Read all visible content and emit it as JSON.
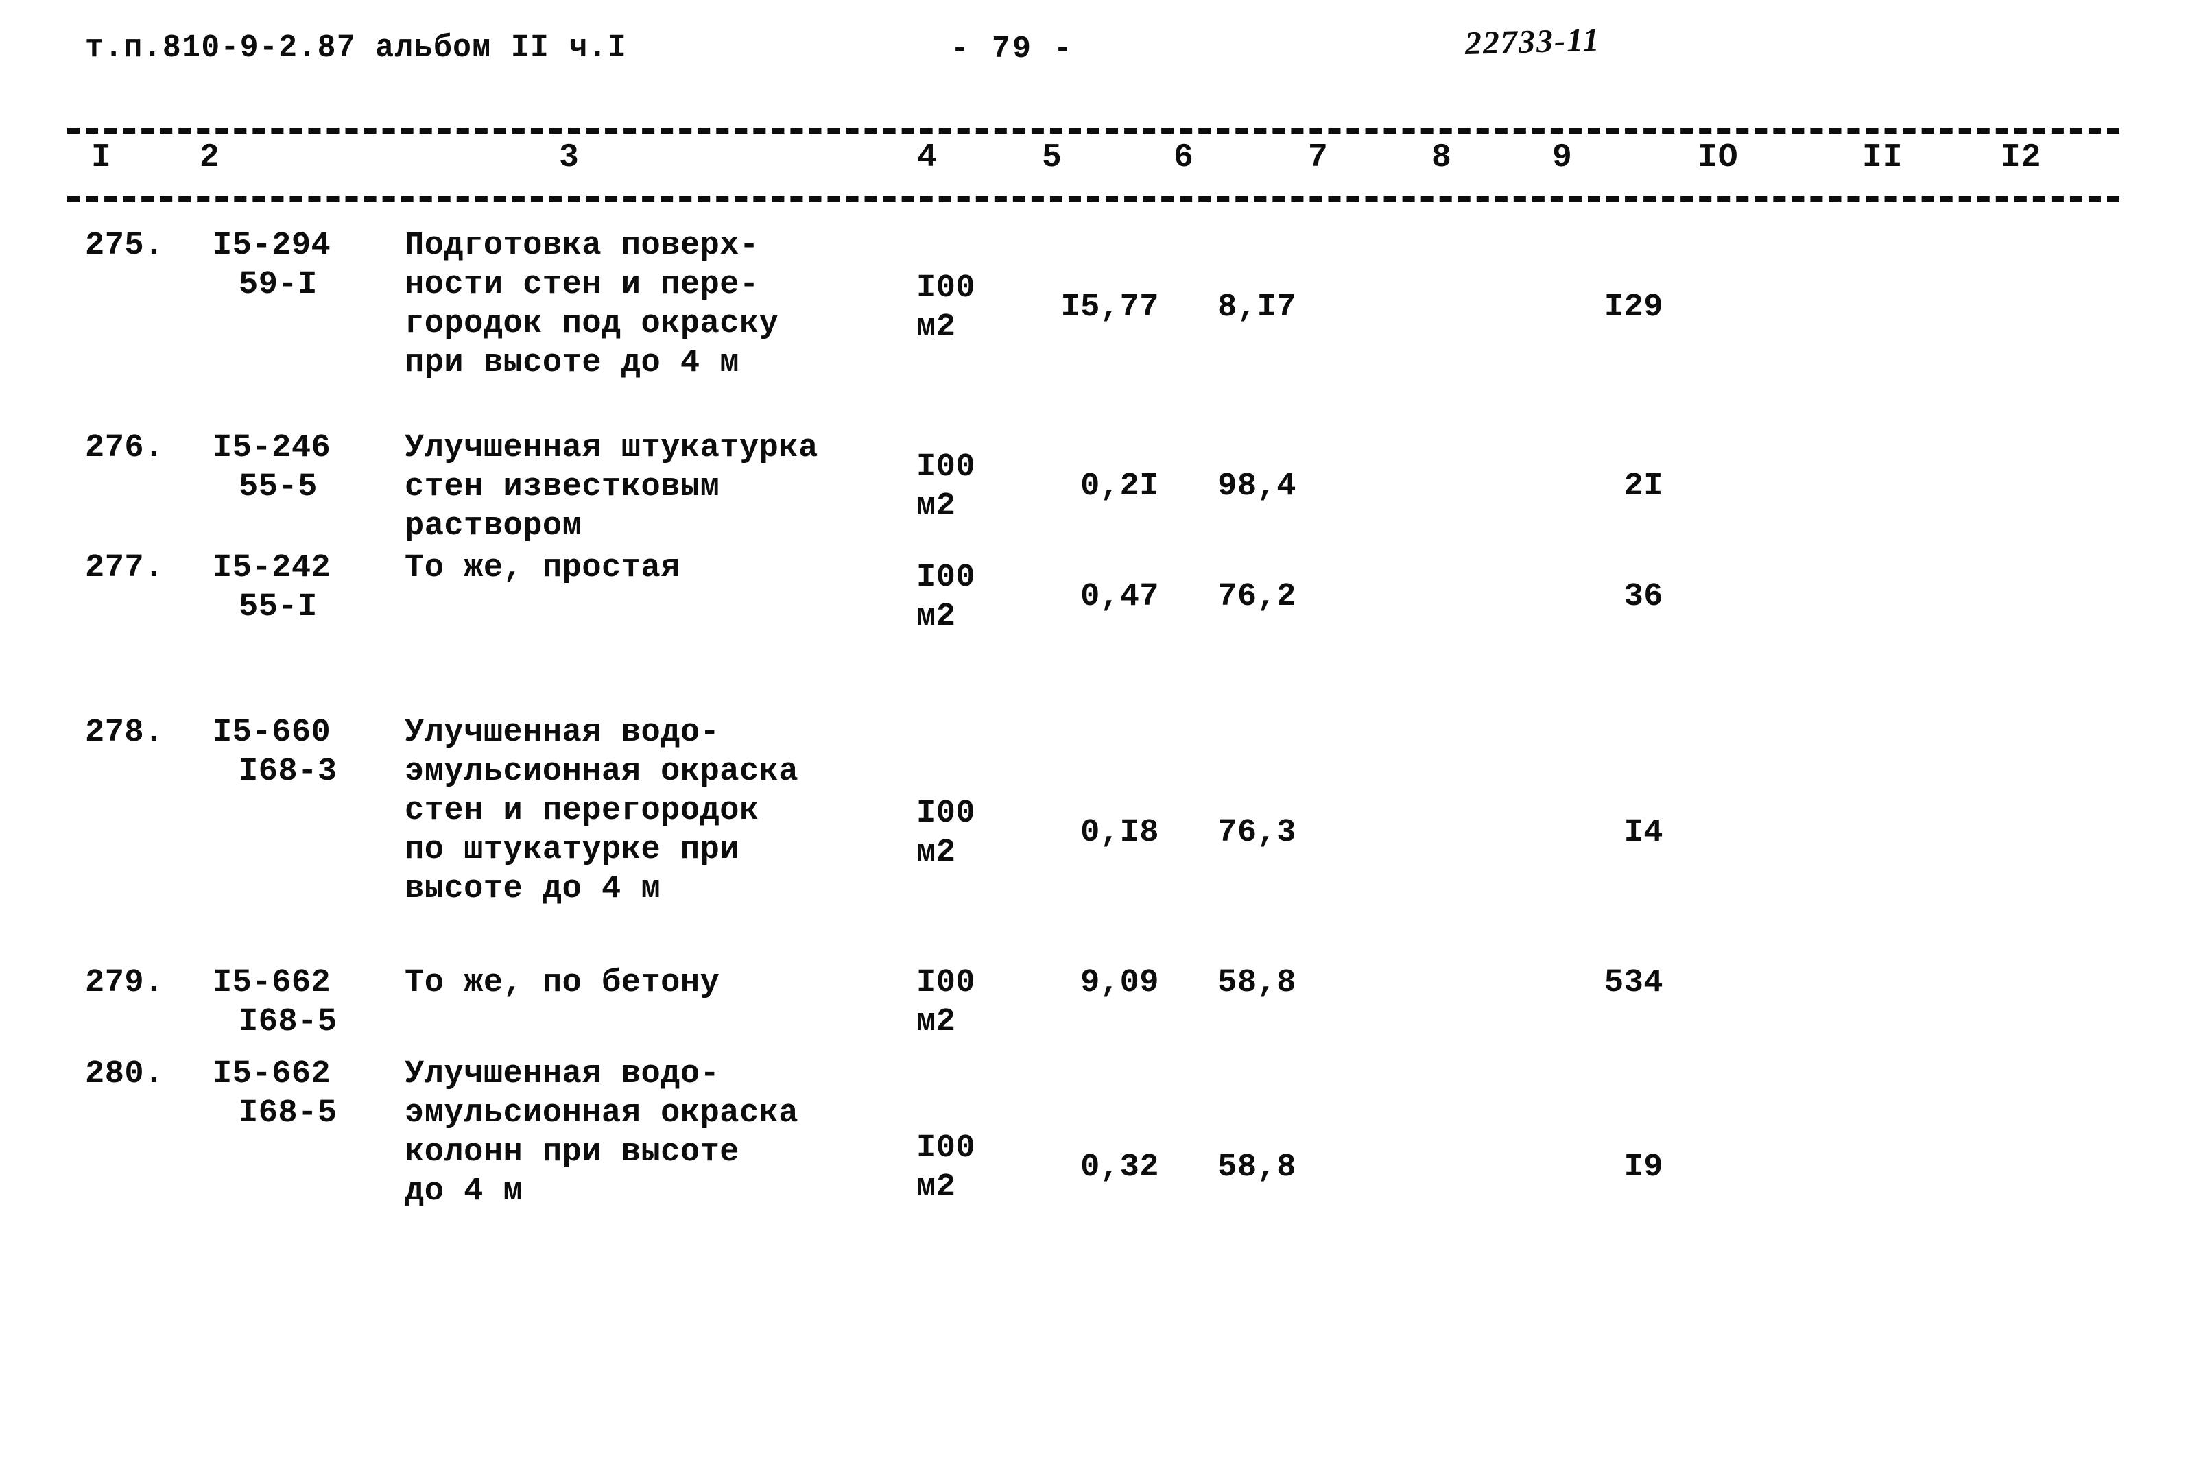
{
  "header": {
    "document_code": "т.п.810-9-2.87 альбом II ч.I",
    "page_number": "- 79 -",
    "archive_stamp": "22733-11"
  },
  "table": {
    "column_numbers": [
      "I",
      "2",
      "3",
      "4",
      "5",
      "6",
      "7",
      "8",
      "9",
      "IO",
      "II",
      "I2"
    ],
    "rows": [
      {
        "num": "275.",
        "code_main": "I5-294",
        "code_sub": "59-I",
        "description": "Подготовка поверх-\nности стен и пере-\nгородок под окраску\nпри высоте до 4 м",
        "unit_top": "I00",
        "unit_bottom": "м2",
        "col5": "I5,77",
        "col6": "8,I7",
        "col7": "",
        "col8": "",
        "col9": "I29",
        "col10": "",
        "col11": "",
        "col12": ""
      },
      {
        "num": "276.",
        "code_main": "I5-246",
        "code_sub": "55-5",
        "description": "Улучшенная штукатурка\nстен известковым\nраствором",
        "unit_top": "I00",
        "unit_bottom": "м2",
        "col5": "0,2I",
        "col6": "98,4",
        "col7": "",
        "col8": "",
        "col9": "2I",
        "col10": "",
        "col11": "",
        "col12": ""
      },
      {
        "num": "277.",
        "code_main": "I5-242",
        "code_sub": "55-I",
        "description": "То же, простая",
        "unit_top": "I00",
        "unit_bottom": "м2",
        "col5": "0,47",
        "col6": "76,2",
        "col7": "",
        "col8": "",
        "col9": "36",
        "col10": "",
        "col11": "",
        "col12": ""
      },
      {
        "num": "278.",
        "code_main": "I5-660",
        "code_sub": "I68-3",
        "description": "Улучшенная водо-\nэмульсионная окраска\nстен и перегородок\nпо штукатурке при\nвысоте до 4 м",
        "unit_top": "I00",
        "unit_bottom": "м2",
        "col5": "0,I8",
        "col6": "76,3",
        "col7": "",
        "col8": "",
        "col9": "I4",
        "col10": "",
        "col11": "",
        "col12": ""
      },
      {
        "num": "279.",
        "code_main": "I5-662",
        "code_sub": "I68-5",
        "description": "То же, по бетону",
        "unit_top": "I00",
        "unit_bottom": "м2",
        "col5": "9,09",
        "col6": "58,8",
        "col7": "",
        "col8": "",
        "col9": "534",
        "col10": "",
        "col11": "",
        "col12": ""
      },
      {
        "num": "280.",
        "code_main": "I5-662",
        "code_sub": "I68-5",
        "description": "Улучшенная водо-\nэмульсионная окраска\nколонн при высоте\nдо 4 м",
        "unit_top": "I00",
        "unit_bottom": "м2",
        "col5": "0,32",
        "col6": "58,8",
        "col7": "",
        "col8": "",
        "col9": "I9",
        "col10": "",
        "col11": "",
        "col12": ""
      }
    ]
  }
}
